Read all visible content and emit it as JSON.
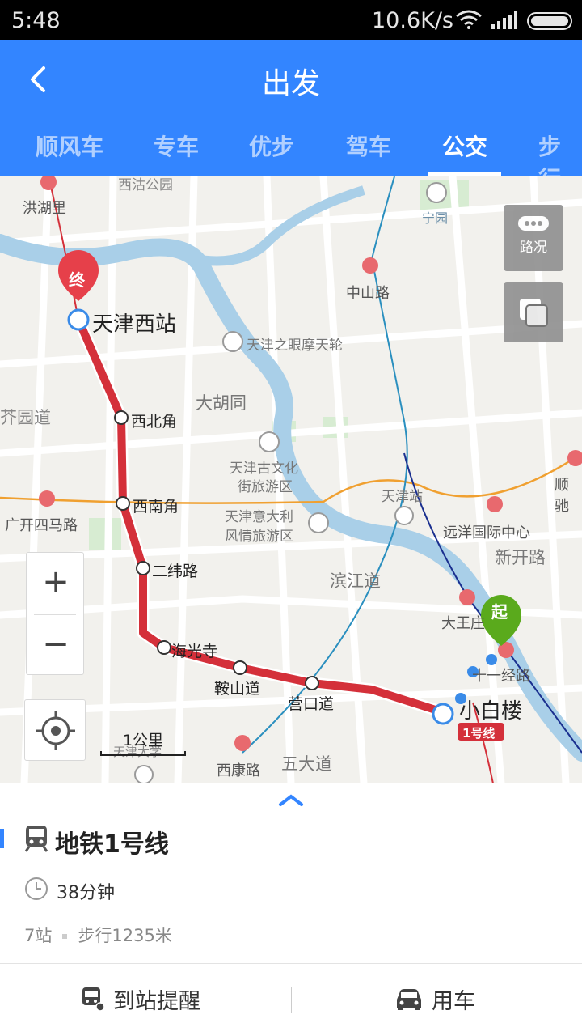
{
  "status_bar": {
    "time": "5:48",
    "net_speed": "10.6K/s"
  },
  "header": {
    "title": "出发",
    "tabs": [
      {
        "label": "顺风车"
      },
      {
        "label": "专车"
      },
      {
        "label": "优步"
      },
      {
        "label": "驾车"
      },
      {
        "label": "公交",
        "active": true
      },
      {
        "label": "步行"
      }
    ]
  },
  "map": {
    "traffic_label": "路况",
    "scale_label": "1公里",
    "markers": {
      "end": "终",
      "start": "起"
    },
    "line_badge": "1号线",
    "stations": [
      "天津西站",
      "西北角",
      "西南角",
      "二纬路",
      "海光寺",
      "鞍山道",
      "营口道",
      "小白楼"
    ],
    "places": [
      "洪湖里",
      "宁园",
      "中山路",
      "天津之眼摩天轮",
      "大胡同",
      "天津古文化",
      "街旅游区",
      "天津站",
      "远洋国际中心",
      "新开路",
      "顺驰",
      "广开四马路",
      "天津意大利",
      "风情旅游区",
      "滨江道",
      "大王庄",
      "十一经路",
      "西康路",
      "五大道",
      "天津大学",
      "芥园道",
      "西沽公园"
    ]
  },
  "route": {
    "title": "地铁1号线",
    "duration": "38分钟",
    "stops": "7站",
    "walk": "步行1235米"
  },
  "actions": {
    "arrival_alert": "到站提醒",
    "ride": "用车"
  },
  "colors": {
    "accent": "#3385ff",
    "route": "#d4303a",
    "start": "#5aaa1c"
  }
}
